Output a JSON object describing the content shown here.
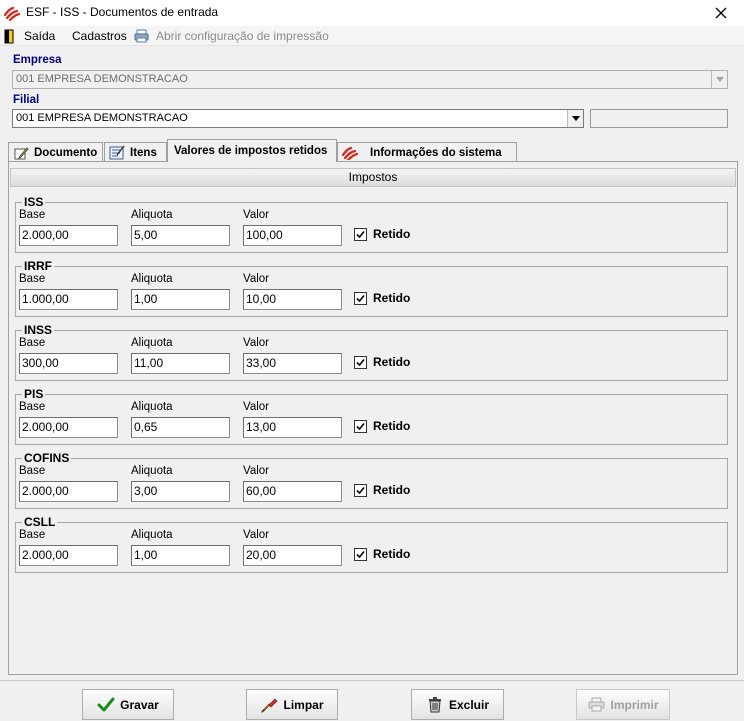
{
  "window": {
    "title": "ESF - ISS - Documentos de entrada"
  },
  "menu": {
    "saida": "Saída",
    "cadastros": "Cadastros",
    "print_config": "Abrir configuração de impressão"
  },
  "empresa": {
    "label": "Empresa",
    "value": "001 EMPRESA DEMONSTRACAO"
  },
  "filial": {
    "label": "Filial",
    "value": "001 EMPRESA DEMONSTRACAO",
    "extra": ""
  },
  "tabs": [
    {
      "label": "Documento",
      "icon": "pencil-icon"
    },
    {
      "label": "Itens",
      "icon": "checklist-icon"
    },
    {
      "label": "Valores de impostos retidos",
      "icon": ""
    },
    {
      "label": "Informações do sistema",
      "icon": "app-logo-icon"
    }
  ],
  "active_tab": 2,
  "section": {
    "title": "Impostos"
  },
  "field_labels": {
    "base": "Base",
    "aliquota": "Aliquota",
    "valor": "Valor",
    "retido": "Retido"
  },
  "taxes": [
    {
      "name": "ISS",
      "base": "2.000,00",
      "aliquota": "5,00",
      "valor": "100,00",
      "retido": true
    },
    {
      "name": "IRRF",
      "base": "1.000,00",
      "aliquota": "1,00",
      "valor": "10,00",
      "retido": true
    },
    {
      "name": "INSS",
      "base": "300,00",
      "aliquota": "11,00",
      "valor": "33,00",
      "retido": true
    },
    {
      "name": "PIS",
      "base": "2.000,00",
      "aliquota": "0,65",
      "valor": "13,00",
      "retido": true
    },
    {
      "name": "COFINS",
      "base": "2.000,00",
      "aliquota": "3,00",
      "valor": "60,00",
      "retido": true
    },
    {
      "name": "CSLL",
      "base": "2.000,00",
      "aliquota": "1,00",
      "valor": "20,00",
      "retido": true
    }
  ],
  "buttons": {
    "gravar": "Gravar",
    "limpar": "Limpar",
    "excluir": "Excluir",
    "imprimir": "Imprimir"
  },
  "colors": {
    "label_blue": "#00007f",
    "logo_red": "#d9261c"
  }
}
